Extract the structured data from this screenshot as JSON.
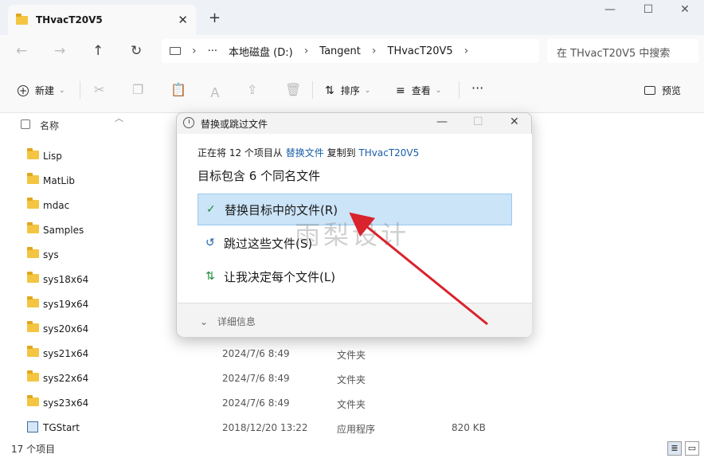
{
  "window": {
    "tab_title": "THvacT20V5",
    "tab_close": "✕",
    "new_tab": "+",
    "min": "—",
    "max": "☐",
    "close": "✕"
  },
  "nav": {
    "back": "←",
    "forward": "→",
    "up": "↑",
    "refresh": "↻"
  },
  "breadcrumb": {
    "more": "···",
    "items": [
      "本地磁盘 (D:)",
      "Tangent",
      "THvacT20V5"
    ],
    "sep": "›"
  },
  "search": {
    "placeholder": "在 THvacT20V5 中搜索"
  },
  "toolbar": {
    "new_label": "新建",
    "sort_label": "排序",
    "view_label": "查看",
    "more": "···",
    "preview_label": "预览"
  },
  "list": {
    "column_name": "名称",
    "rows": [
      {
        "name": "Lisp",
        "date": "",
        "type": "",
        "size": ""
      },
      {
        "name": "MatLib",
        "date": "",
        "type": "",
        "size": ""
      },
      {
        "name": "mdac",
        "date": "",
        "type": "",
        "size": ""
      },
      {
        "name": "Samples",
        "date": "",
        "type": "",
        "size": ""
      },
      {
        "name": "sys",
        "date": "",
        "type": "",
        "size": ""
      },
      {
        "name": "sys18x64",
        "date": "",
        "type": "",
        "size": ""
      },
      {
        "name": "sys19x64",
        "date": "",
        "type": "",
        "size": ""
      },
      {
        "name": "sys20x64",
        "date": "",
        "type": "",
        "size": ""
      },
      {
        "name": "sys21x64",
        "date": "2024/7/6 8:49",
        "type": "文件夹",
        "size": ""
      },
      {
        "name": "sys22x64",
        "date": "2024/7/6 8:49",
        "type": "文件夹",
        "size": ""
      },
      {
        "name": "sys23x64",
        "date": "2024/7/6 8:49",
        "type": "文件夹",
        "size": ""
      },
      {
        "name": "TGStart",
        "date": "2018/12/20 13:22",
        "type": "应用程序",
        "size": "820 KB"
      }
    ]
  },
  "status": {
    "count": "17 个项目"
  },
  "dialog": {
    "title": "替换或跳过文件",
    "line1_prefix": "正在将 12 个项目从",
    "line1_src": "替换文件",
    "line1_mid": "复制到",
    "line1_dst": "THvacT20V5",
    "line2": "目标包含 6 个同名文件",
    "options": [
      {
        "label": "替换目标中的文件(R)",
        "icon": "✓"
      },
      {
        "label": "跳过这些文件(S)",
        "icon": "↺"
      },
      {
        "label": "让我决定每个文件(L)",
        "icon": "⇅"
      }
    ],
    "details": "详细信息",
    "details_icon": "⌄"
  },
  "watermark": "雨梨设计",
  "colors": {
    "accent": "#1a5ea8",
    "selected_bg": "#cce4f7",
    "arrow": "#d9232d",
    "folder": "#f4c542"
  }
}
